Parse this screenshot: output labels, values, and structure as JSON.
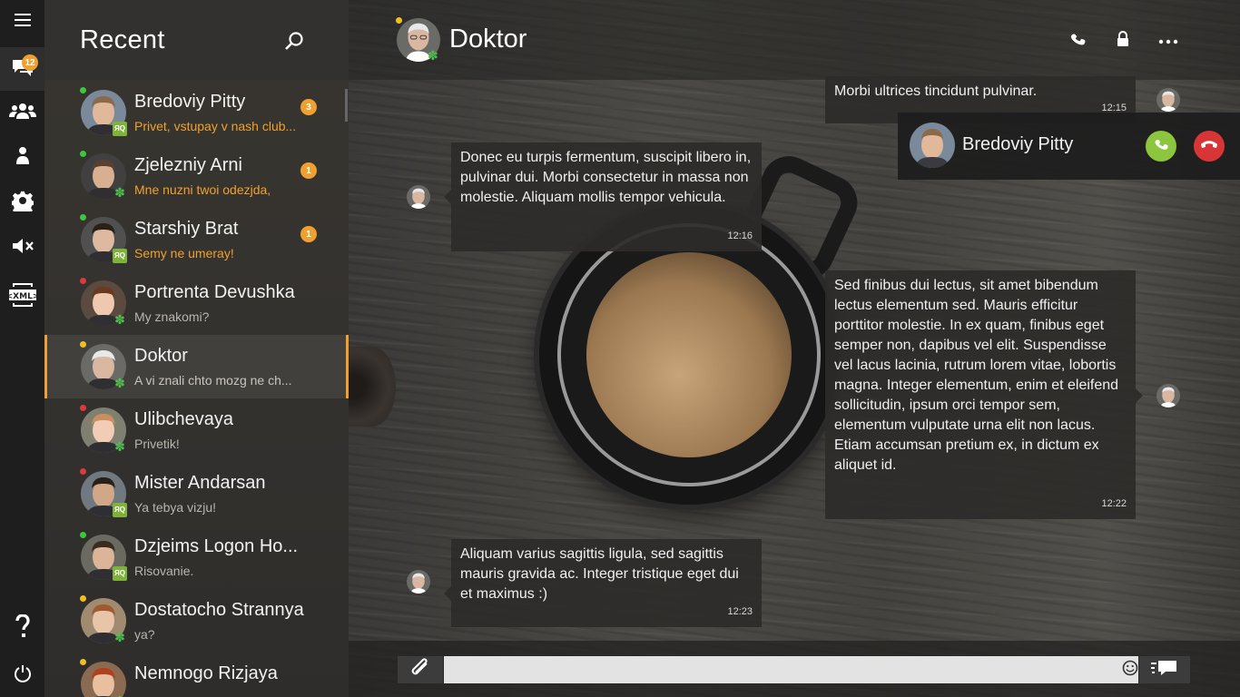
{
  "colors": {
    "accent": "#f0a030",
    "online": "#3cc83c",
    "away": "#f0c020",
    "busy": "#d83c3c",
    "icq": "#4dc04d",
    "call_accept": "#8cc63f",
    "call_decline": "#d83636"
  },
  "rail": {
    "items": [
      {
        "icon": "menu-icon"
      },
      {
        "icon": "chats-icon",
        "badge": "12"
      },
      {
        "icon": "groups-icon"
      },
      {
        "icon": "contact-icon"
      },
      {
        "icon": "gear-icon"
      },
      {
        "icon": "mute-icon"
      },
      {
        "icon": "xml-icon",
        "label": "XML"
      },
      {
        "icon": "help-icon"
      },
      {
        "icon": "power-icon"
      }
    ]
  },
  "recent": {
    "title": "Recent",
    "contacts": [
      {
        "name": "Bredoviy Pitty",
        "preview": "Privet, vstupay v nash club...",
        "status": "online",
        "network": "sq",
        "unread": "3"
      },
      {
        "name": "Zjelezniy Arni",
        "preview": "Mne nuzni twoi odezjda,",
        "status": "online",
        "network": "icq",
        "unread": "1"
      },
      {
        "name": "Starshiy Brat",
        "preview": "Semy ne umeray!",
        "status": "online",
        "network": "sq",
        "unread": "1"
      },
      {
        "name": "Portrenta Devushka",
        "preview": "My znakomi?",
        "status": "busy",
        "network": "icq",
        "unread": ""
      },
      {
        "name": "Doktor",
        "preview": "A vi znali chto mozg ne ch...",
        "status": "away",
        "network": "icq",
        "unread": ""
      },
      {
        "name": "Ulibchevaya",
        "preview": "Privetik!",
        "status": "busy",
        "network": "icq",
        "unread": ""
      },
      {
        "name": "Mister Andarsan",
        "preview": "Ya tebya vizju!",
        "status": "busy",
        "network": "sq",
        "unread": ""
      },
      {
        "name": "Dzjeims Logon Ho...",
        "preview": "Risovanie.",
        "status": "online",
        "network": "sq",
        "unread": ""
      },
      {
        "name": "Dostatocho Strannya",
        "preview": "ya?",
        "status": "away",
        "network": "icq",
        "unread": ""
      },
      {
        "name": "Nemnogo Rizjaya",
        "preview": "",
        "status": "away",
        "network": "icq",
        "unread": ""
      }
    ]
  },
  "chat": {
    "title": "Doktor",
    "header_icons": [
      "call-icon",
      "lock-icon",
      "more-icon"
    ],
    "messages": [
      {
        "direction": "out",
        "text": "Morbi ultrices tincidunt pulvinar.",
        "time": "12:15"
      },
      {
        "direction": "in",
        "text": "Donec eu turpis fermentum, suscipit libero in, pulvinar dui. Morbi consectetur in massa non molestie. Aliquam mollis tempor vehicula.",
        "time": "12:16"
      },
      {
        "direction": "out",
        "text": "Sed finibus dui lectus, sit amet bibendum lectus elementum sed. Mauris efficitur porttitor molestie. In ex quam, finibus eget semper non, dapibus vel elit. Suspendisse vel lacus lacinia, rutrum lorem vitae, lobortis magna. Integer elementum, enim et eleifend sollicitudin, ipsum orci tempor sem, elementum vulputate urna elit non lacus. Etiam accumsan pretium ex, in dictum ex aliquet id.",
        "time": "12:22"
      },
      {
        "direction": "in",
        "text": "Aliquam varius sagittis ligula, sed sagittis mauris gravida ac. Integer tristique eget dui et maximus :)",
        "time": "12:23"
      }
    ],
    "incoming_call": {
      "name": "Bredoviy Pitty"
    },
    "input": {
      "value": "",
      "placeholder": ""
    }
  }
}
